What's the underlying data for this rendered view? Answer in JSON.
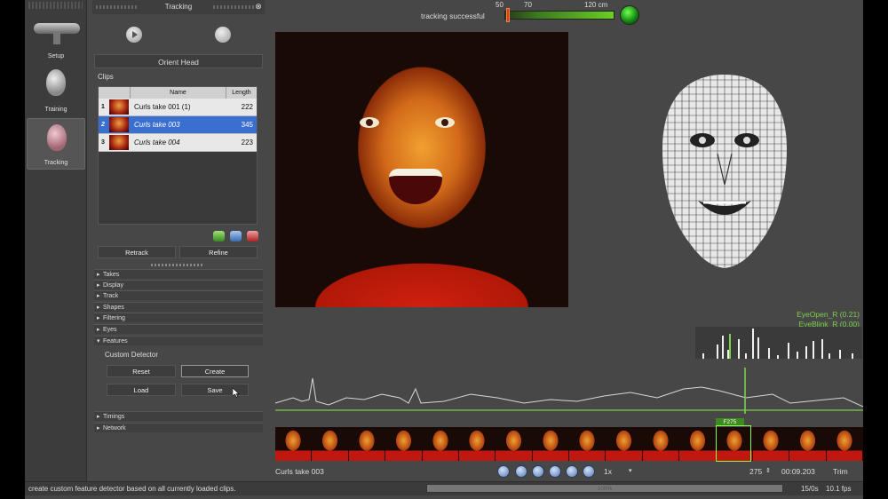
{
  "rail": {
    "items": [
      {
        "label": "Setup"
      },
      {
        "label": "Training"
      },
      {
        "label": "Tracking"
      }
    ]
  },
  "panel": {
    "title": "Tracking",
    "close_glyph": "⊗",
    "orient_label": "Orient Head",
    "clips_label": "Clips",
    "columns": {
      "name": "Name",
      "length": "Length"
    },
    "clips": [
      {
        "num": "1",
        "name": "Curls take 001 (1)",
        "length": "222"
      },
      {
        "num": "2",
        "name": "Curls take 003",
        "length": "345"
      },
      {
        "num": "3",
        "name": "Curls take 004",
        "length": "223"
      }
    ],
    "retrack_label": "Retrack",
    "refine_label": "Refine",
    "sections": [
      "Takes",
      "Display",
      "Track",
      "Shapes",
      "Filtering",
      "Eyes",
      "Features"
    ],
    "sections_bottom": [
      "Timings",
      "Network"
    ],
    "custom_detector_label": "Custom Detector",
    "reset_label": "Reset",
    "create_label": "Create",
    "load_label": "Load",
    "save_label": "Save"
  },
  "top": {
    "status_text": "tracking successful",
    "scale": [
      "50",
      "70",
      "120 cm"
    ]
  },
  "blendshapes": [
    "EyeOpen_R (0.21)",
    "EyeBlink_R (0.00)"
  ],
  "timeline": {
    "frame_tag": "F275",
    "clip_name": "Curls take 003",
    "speed": "1x",
    "frame": "275",
    "time": "00:09.203",
    "trim_label": "Trim"
  },
  "statusbar": {
    "hint": "create custom feature detector based on all currently loaded clips.",
    "progress_text": "100%",
    "rate": "15/0s",
    "fps": "10.1 fps"
  },
  "colors": {
    "accent": "#3a6fd0",
    "good": "#7ad04a",
    "panel": "#474747"
  }
}
